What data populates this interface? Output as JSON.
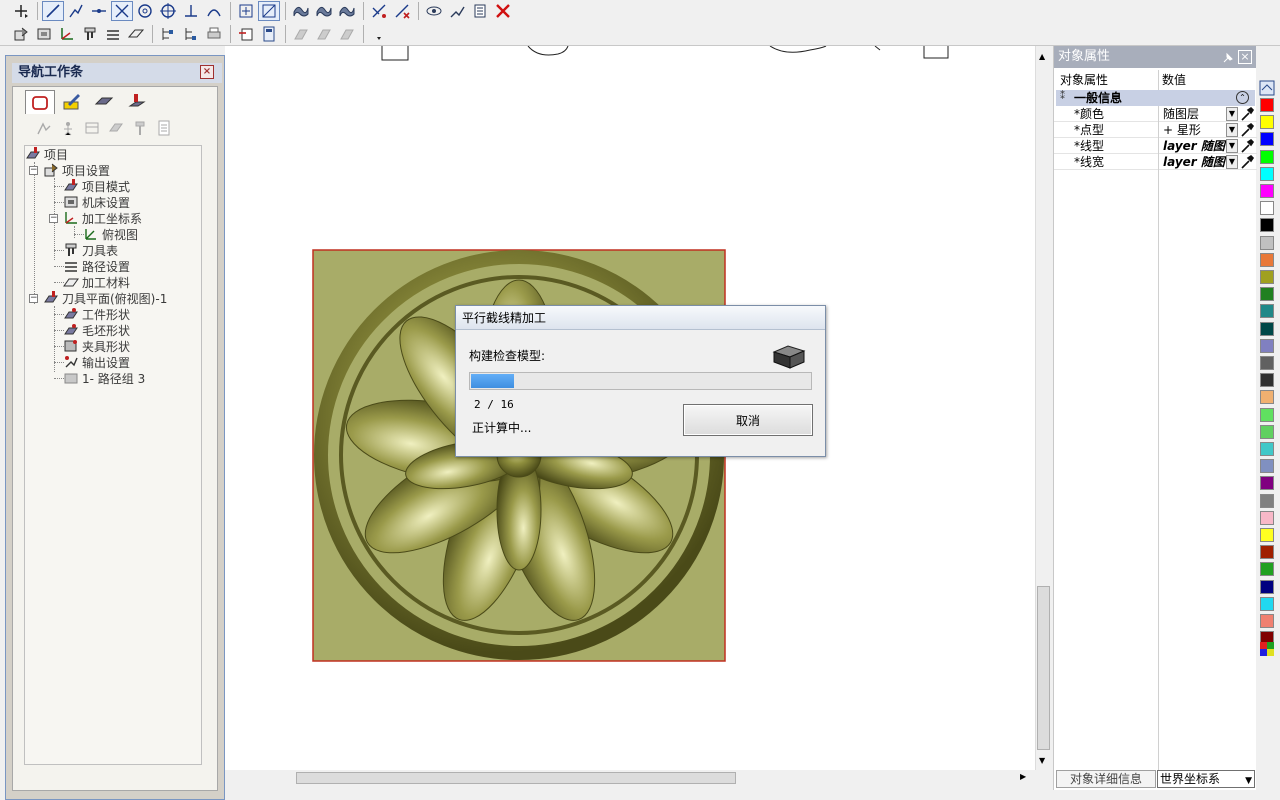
{
  "toolbar": {
    "row1_icons": [
      "snap-menu-icon",
      "line-icon",
      "polyline-icon",
      "point-line-icon",
      "cross-icon",
      "circle-icon",
      "circle-target-icon",
      "tee-icon",
      "arc-icon",
      "add-box-icon",
      "diagonal-box-icon",
      "surface1-icon",
      "surface2-icon",
      "surface3-icon",
      "trim-icon",
      "trim-x-icon",
      "eye-icon",
      "connect-icon",
      "list-icon",
      "delete-icon"
    ],
    "row2_icons": [
      "project-icon",
      "machine-icon",
      "axis-icon",
      "tool-icon",
      "path-icon",
      "material-icon",
      "tree-icon",
      "tree2-icon",
      "print-icon",
      "export-icon",
      "calc-icon",
      "disabled1-icon",
      "disabled2-icon",
      "disabled3-icon",
      "more-icon"
    ]
  },
  "nav_panel": {
    "title": "导航工作条",
    "close_label": "×",
    "tree": [
      {
        "label": "项目",
        "level": 0
      },
      {
        "label": "项目设置",
        "level": 1
      },
      {
        "label": "项目模式",
        "level": 2
      },
      {
        "label": "机床设置",
        "level": 2
      },
      {
        "label": "加工坐标系",
        "level": 2
      },
      {
        "label": "俯视图",
        "level": 3
      },
      {
        "label": "刀具表",
        "level": 2
      },
      {
        "label": "路径设置",
        "level": 2
      },
      {
        "label": "加工材料",
        "level": 2
      },
      {
        "label": "刀具平面(俯视图)-1",
        "level": 1
      },
      {
        "label": "工件形状",
        "level": 2
      },
      {
        "label": "毛坯形状",
        "level": 2
      },
      {
        "label": "夹具形状",
        "level": 2
      },
      {
        "label": "输出设置",
        "level": 2
      },
      {
        "label": "1- 路径组 3",
        "level": 2
      }
    ]
  },
  "dialog": {
    "title": "平行截线精加工",
    "message": "构建检查模型:",
    "progress_fraction": 0.125,
    "counter": "2 / 16",
    "status": "正计算中...",
    "cancel_label": "取消"
  },
  "properties": {
    "title": "对象属性",
    "col_name": "对象属性",
    "col_value": "数值",
    "group": "一般信息",
    "rows": [
      {
        "name": "*颜色",
        "value": "随图层"
      },
      {
        "name": "*点型",
        "value": "+ 星形"
      },
      {
        "name": "*线型",
        "value": "layer 随图"
      },
      {
        "name": "*线宽",
        "value": "layer 随图"
      }
    ],
    "bottom_tab": "对象详细信息",
    "coord_system": "世界坐标系"
  },
  "palette": {
    "colors": [
      "#ff0000",
      "#ffff00",
      "#0000ff",
      "#00ff00",
      "#00ffff",
      "#ff00ff",
      "#ffffff",
      "#000000",
      "#c0c0c0",
      "#e87838",
      "#a0a020",
      "#208020",
      "#208888",
      "#004848",
      "#8080c0",
      "#606060",
      "#303030",
      "#f0b070",
      "#60e060",
      "#60d060",
      "#40c8c8",
      "#8090c0",
      "#800080",
      "#808080",
      "#f8b8c8",
      "#ffff20",
      "#a02000",
      "#20a020",
      "#000080",
      "#20d8f0",
      "#f08070",
      "#800000"
    ]
  },
  "colors": {
    "accent": "#3f8fe0",
    "relief_bg": "#a8ac68",
    "relief_border": "#c03020"
  }
}
